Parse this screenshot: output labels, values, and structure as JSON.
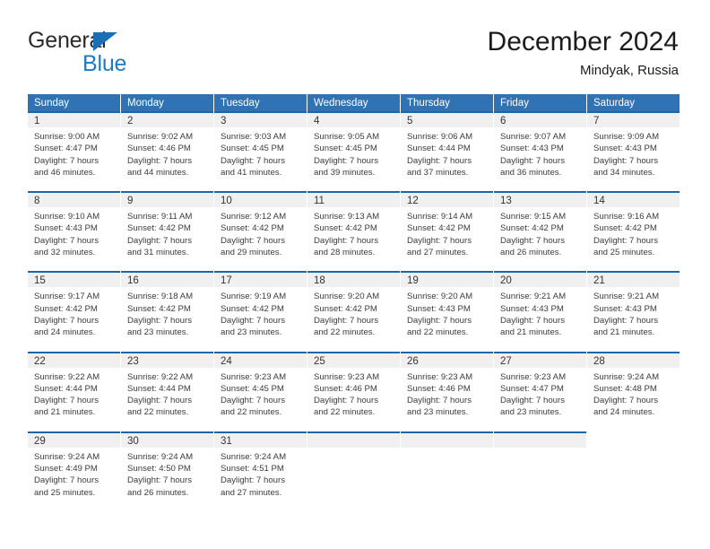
{
  "brand": {
    "name_part1": "General",
    "name_part2": "Blue",
    "triangle_color": "#1a6fb5",
    "blue_text_color": "#1f7bc1"
  },
  "header": {
    "title": "December 2024",
    "location": "Mindyak, Russia"
  },
  "theme": {
    "header_blue": "#3073b4",
    "cell_top_border_blue": "#1d66ab",
    "daynum_background": "#f0f0f0"
  },
  "weekdays": [
    "Sunday",
    "Monday",
    "Tuesday",
    "Wednesday",
    "Thursday",
    "Friday",
    "Saturday"
  ],
  "weeks": [
    [
      {
        "day": "1",
        "sunrise": "Sunrise: 9:00 AM",
        "sunset": "Sunset: 4:47 PM",
        "daylight1": "Daylight: 7 hours",
        "daylight2": "and 46 minutes."
      },
      {
        "day": "2",
        "sunrise": "Sunrise: 9:02 AM",
        "sunset": "Sunset: 4:46 PM",
        "daylight1": "Daylight: 7 hours",
        "daylight2": "and 44 minutes."
      },
      {
        "day": "3",
        "sunrise": "Sunrise: 9:03 AM",
        "sunset": "Sunset: 4:45 PM",
        "daylight1": "Daylight: 7 hours",
        "daylight2": "and 41 minutes."
      },
      {
        "day": "4",
        "sunrise": "Sunrise: 9:05 AM",
        "sunset": "Sunset: 4:45 PM",
        "daylight1": "Daylight: 7 hours",
        "daylight2": "and 39 minutes."
      },
      {
        "day": "5",
        "sunrise": "Sunrise: 9:06 AM",
        "sunset": "Sunset: 4:44 PM",
        "daylight1": "Daylight: 7 hours",
        "daylight2": "and 37 minutes."
      },
      {
        "day": "6",
        "sunrise": "Sunrise: 9:07 AM",
        "sunset": "Sunset: 4:43 PM",
        "daylight1": "Daylight: 7 hours",
        "daylight2": "and 36 minutes."
      },
      {
        "day": "7",
        "sunrise": "Sunrise: 9:09 AM",
        "sunset": "Sunset: 4:43 PM",
        "daylight1": "Daylight: 7 hours",
        "daylight2": "and 34 minutes."
      }
    ],
    [
      {
        "day": "8",
        "sunrise": "Sunrise: 9:10 AM",
        "sunset": "Sunset: 4:43 PM",
        "daylight1": "Daylight: 7 hours",
        "daylight2": "and 32 minutes."
      },
      {
        "day": "9",
        "sunrise": "Sunrise: 9:11 AM",
        "sunset": "Sunset: 4:42 PM",
        "daylight1": "Daylight: 7 hours",
        "daylight2": "and 31 minutes."
      },
      {
        "day": "10",
        "sunrise": "Sunrise: 9:12 AM",
        "sunset": "Sunset: 4:42 PM",
        "daylight1": "Daylight: 7 hours",
        "daylight2": "and 29 minutes."
      },
      {
        "day": "11",
        "sunrise": "Sunrise: 9:13 AM",
        "sunset": "Sunset: 4:42 PM",
        "daylight1": "Daylight: 7 hours",
        "daylight2": "and 28 minutes."
      },
      {
        "day": "12",
        "sunrise": "Sunrise: 9:14 AM",
        "sunset": "Sunset: 4:42 PM",
        "daylight1": "Daylight: 7 hours",
        "daylight2": "and 27 minutes."
      },
      {
        "day": "13",
        "sunrise": "Sunrise: 9:15 AM",
        "sunset": "Sunset: 4:42 PM",
        "daylight1": "Daylight: 7 hours",
        "daylight2": "and 26 minutes."
      },
      {
        "day": "14",
        "sunrise": "Sunrise: 9:16 AM",
        "sunset": "Sunset: 4:42 PM",
        "daylight1": "Daylight: 7 hours",
        "daylight2": "and 25 minutes."
      }
    ],
    [
      {
        "day": "15",
        "sunrise": "Sunrise: 9:17 AM",
        "sunset": "Sunset: 4:42 PM",
        "daylight1": "Daylight: 7 hours",
        "daylight2": "and 24 minutes."
      },
      {
        "day": "16",
        "sunrise": "Sunrise: 9:18 AM",
        "sunset": "Sunset: 4:42 PM",
        "daylight1": "Daylight: 7 hours",
        "daylight2": "and 23 minutes."
      },
      {
        "day": "17",
        "sunrise": "Sunrise: 9:19 AM",
        "sunset": "Sunset: 4:42 PM",
        "daylight1": "Daylight: 7 hours",
        "daylight2": "and 23 minutes."
      },
      {
        "day": "18",
        "sunrise": "Sunrise: 9:20 AM",
        "sunset": "Sunset: 4:42 PM",
        "daylight1": "Daylight: 7 hours",
        "daylight2": "and 22 minutes."
      },
      {
        "day": "19",
        "sunrise": "Sunrise: 9:20 AM",
        "sunset": "Sunset: 4:43 PM",
        "daylight1": "Daylight: 7 hours",
        "daylight2": "and 22 minutes."
      },
      {
        "day": "20",
        "sunrise": "Sunrise: 9:21 AM",
        "sunset": "Sunset: 4:43 PM",
        "daylight1": "Daylight: 7 hours",
        "daylight2": "and 21 minutes."
      },
      {
        "day": "21",
        "sunrise": "Sunrise: 9:21 AM",
        "sunset": "Sunset: 4:43 PM",
        "daylight1": "Daylight: 7 hours",
        "daylight2": "and 21 minutes."
      }
    ],
    [
      {
        "day": "22",
        "sunrise": "Sunrise: 9:22 AM",
        "sunset": "Sunset: 4:44 PM",
        "daylight1": "Daylight: 7 hours",
        "daylight2": "and 21 minutes."
      },
      {
        "day": "23",
        "sunrise": "Sunrise: 9:22 AM",
        "sunset": "Sunset: 4:44 PM",
        "daylight1": "Daylight: 7 hours",
        "daylight2": "and 22 minutes."
      },
      {
        "day": "24",
        "sunrise": "Sunrise: 9:23 AM",
        "sunset": "Sunset: 4:45 PM",
        "daylight1": "Daylight: 7 hours",
        "daylight2": "and 22 minutes."
      },
      {
        "day": "25",
        "sunrise": "Sunrise: 9:23 AM",
        "sunset": "Sunset: 4:46 PM",
        "daylight1": "Daylight: 7 hours",
        "daylight2": "and 22 minutes."
      },
      {
        "day": "26",
        "sunrise": "Sunrise: 9:23 AM",
        "sunset": "Sunset: 4:46 PM",
        "daylight1": "Daylight: 7 hours",
        "daylight2": "and 23 minutes."
      },
      {
        "day": "27",
        "sunrise": "Sunrise: 9:23 AM",
        "sunset": "Sunset: 4:47 PM",
        "daylight1": "Daylight: 7 hours",
        "daylight2": "and 23 minutes."
      },
      {
        "day": "28",
        "sunrise": "Sunrise: 9:24 AM",
        "sunset": "Sunset: 4:48 PM",
        "daylight1": "Daylight: 7 hours",
        "daylight2": "and 24 minutes."
      }
    ],
    [
      {
        "day": "29",
        "sunrise": "Sunrise: 9:24 AM",
        "sunset": "Sunset: 4:49 PM",
        "daylight1": "Daylight: 7 hours",
        "daylight2": "and 25 minutes."
      },
      {
        "day": "30",
        "sunrise": "Sunrise: 9:24 AM",
        "sunset": "Sunset: 4:50 PM",
        "daylight1": "Daylight: 7 hours",
        "daylight2": "and 26 minutes."
      },
      {
        "day": "31",
        "sunrise": "Sunrise: 9:24 AM",
        "sunset": "Sunset: 4:51 PM",
        "daylight1": "Daylight: 7 hours",
        "daylight2": "and 27 minutes."
      },
      {
        "day": "",
        "sunrise": "",
        "sunset": "",
        "daylight1": "",
        "daylight2": ""
      },
      {
        "day": "",
        "sunrise": "",
        "sunset": "",
        "daylight1": "",
        "daylight2": ""
      },
      {
        "day": "",
        "sunrise": "",
        "sunset": "",
        "daylight1": "",
        "daylight2": ""
      },
      {
        "day": "",
        "sunrise": "",
        "sunset": "",
        "daylight1": "",
        "daylight2": ""
      }
    ]
  ]
}
